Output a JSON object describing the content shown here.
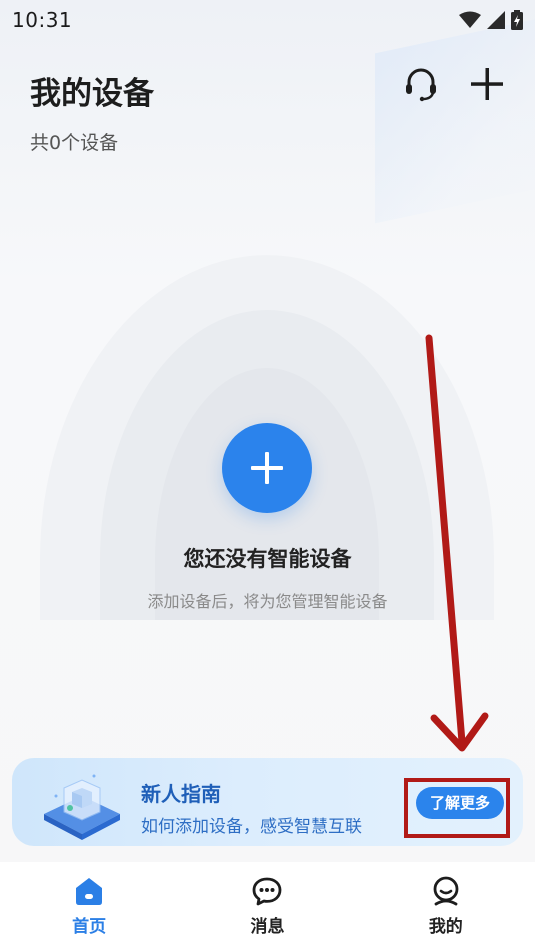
{
  "status_bar": {
    "time": "10:31"
  },
  "header": {
    "title": "我的设备",
    "device_count": "共0个设备",
    "actions": [
      {
        "icon": "headset-icon"
      },
      {
        "icon": "plus-icon"
      }
    ]
  },
  "empty_state": {
    "title": "您还没有智能设备",
    "subtitle": "添加设备后，将为您管理智能设备",
    "add_icon": "plus-icon"
  },
  "guide_banner": {
    "title": "新人指南",
    "subtitle": "如何添加设备，感受智慧互联",
    "button_label": "了解更多"
  },
  "bottom_nav": {
    "items": [
      {
        "label": "首页",
        "icon": "home-icon",
        "active": true
      },
      {
        "label": "消息",
        "icon": "chat-icon",
        "active": false
      },
      {
        "label": "我的",
        "icon": "profile-icon",
        "active": false
      }
    ]
  },
  "colors": {
    "accent": "#2b83ec",
    "annotation": "#b11a17",
    "banner_title": "#1f5fb8"
  }
}
